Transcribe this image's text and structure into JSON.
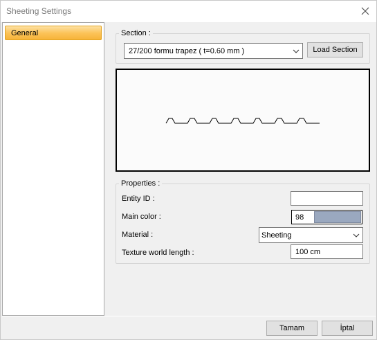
{
  "window": {
    "title": "Sheeting Settings"
  },
  "sidebar": {
    "items": [
      {
        "label": "General",
        "selected": true
      }
    ]
  },
  "section": {
    "group_label": "Section :",
    "selected": "27/200 formu trapez ( t=0.60 mm )",
    "load_button": "Load Section"
  },
  "properties": {
    "group_label": "Properties :",
    "entity_id_label": "Entity ID :",
    "entity_id_value": "",
    "main_color_label": "Main color :",
    "main_color_value": "98",
    "main_color_hex": "#9aa8bf",
    "material_label": "Material :",
    "material_value": "Sheeting",
    "texture_label": "Texture world length :",
    "texture_value": "100 cm"
  },
  "footer": {
    "ok_label": "Tamam",
    "cancel_label": "İptal"
  },
  "icons": {
    "close": "close-icon",
    "dropdown": "chevron-down-icon"
  }
}
